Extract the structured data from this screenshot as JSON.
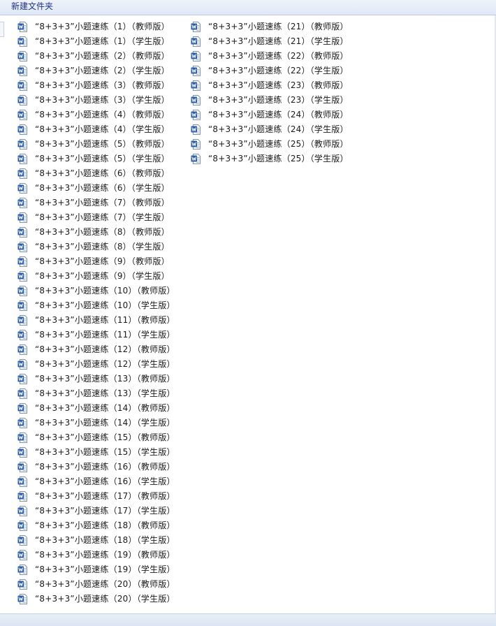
{
  "window": {
    "title": "新建文件夹"
  },
  "file_icon": "word-doc-icon",
  "colors": {
    "titlebar": "#dfe8f6",
    "title_text": "#1e3287",
    "icon_blue": "#2a5caa"
  },
  "files": {
    "column1": [
      "“8+3+3”小题速练（1）（教师版）",
      "“8+3+3”小题速练（1）（学生版）",
      "“8+3+3”小题速练（2）（教师版）",
      "“8+3+3”小题速练（2）（学生版）",
      "“8+3+3”小题速练（3）（教师版）",
      "“8+3+3”小题速练（3）（学生版）",
      "“8+3+3”小题速练（4）（教师版）",
      "“8+3+3”小题速练（4）（学生版）",
      "“8+3+3”小题速练（5）（教师版）",
      "“8+3+3”小题速练（5）（学生版）",
      "“8+3+3”小题速练（6）（教师版）",
      "“8+3+3”小题速练（6）（学生版）",
      "“8+3+3”小题速练（7）（教师版）",
      "“8+3+3”小题速练（7）（学生版）",
      "“8+3+3”小题速练（8）（教师版）",
      "“8+3+3”小题速练（8）（学生版）",
      "“8+3+3”小题速练（9）（教师版）",
      "“8+3+3”小题速练（9）（学生版）",
      "“8+3+3”小题速练（10）（教师版）",
      "“8+3+3”小题速练（10）（学生版）",
      "“8+3+3”小题速练（11）（教师版）",
      "“8+3+3”小题速练（11）（学生版）",
      "“8+3+3”小题速练（12）（教师版）",
      "“8+3+3”小题速练（12）（学生版）",
      "“8+3+3”小题速练（13）（教师版）",
      "“8+3+3”小题速练（13）（学生版）",
      "“8+3+3”小题速练（14）（教师版）",
      "“8+3+3”小题速练（14）（学生版）",
      "“8+3+3”小题速练（15）（教师版）",
      "“8+3+3”小题速练（15）（学生版）",
      "“8+3+3”小题速练（16）（教师版）",
      "“8+3+3”小题速练（16）（学生版）",
      "“8+3+3”小题速练（17）（教师版）",
      "“8+3+3”小题速练（17）（学生版）",
      "“8+3+3”小题速练（18）（教师版）",
      "“8+3+3”小题速练（18）（学生版）",
      "“8+3+3”小题速练（19）（教师版）",
      "“8+3+3”小题速练（19）（学生版）",
      "“8+3+3”小题速练（20）（教师版）",
      "“8+3+3”小题速练（20）（学生版）"
    ],
    "column2": [
      "“8+3+3”小题速练（21）（教师版）",
      "“8+3+3”小题速练（21）（学生版）",
      "“8+3+3”小题速练（22）（教师版）",
      "“8+3+3”小题速练（22）（学生版）",
      "“8+3+3”小题速练（23）（教师版）",
      "“8+3+3”小题速练（23）（学生版）",
      "“8+3+3”小题速练（24）（教师版）",
      "“8+3+3”小题速练（24）（学生版）",
      "“8+3+3”小题速练（25）（教师版）",
      "“8+3+3”小题速练（25）（学生版）"
    ]
  }
}
